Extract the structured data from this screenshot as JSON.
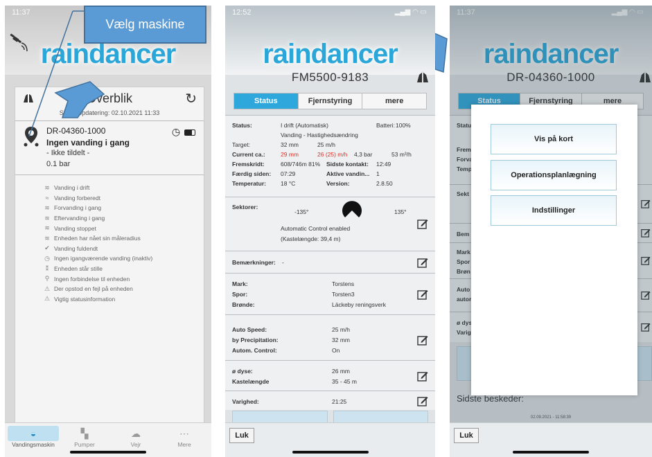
{
  "callout": {
    "label": "Vælg maskine"
  },
  "panel1": {
    "status_time": "11:37",
    "logo": "raindancer",
    "overview": {
      "title": "Overblik",
      "last_update": "Sidste opdatering: 02.10.2021 11:33"
    },
    "machine": {
      "id": "DR-04360-1000",
      "status": "Ingen vanding i gang",
      "assigned": "- Ikke tildelt -",
      "pressure": "0.1 bar"
    },
    "legend": [
      {
        "icon": "sprinkler-icon",
        "glyph": "≋",
        "label": "Vanding i drift"
      },
      {
        "icon": "sprinkler-ready-icon",
        "glyph": "≈",
        "label": "Vanding forberedt"
      },
      {
        "icon": "pre-irrigation-icon",
        "glyph": "≋",
        "label": "Forvanding i gang"
      },
      {
        "icon": "post-irrigation-icon",
        "glyph": "≋",
        "label": "Eftervanding i gang"
      },
      {
        "icon": "irrigation-stopped-icon",
        "glyph": "≋",
        "label": "Vanding stoppet"
      },
      {
        "icon": "radius-reached-icon",
        "glyph": "≋",
        "label": "Enheden har nået sin måleradius"
      },
      {
        "icon": "checkmark-icon",
        "glyph": "✔",
        "label": "Vanding fuldendt"
      },
      {
        "icon": "clock-icon",
        "glyph": "◷",
        "label": "Ingen igangværende vanding (inaktiv)"
      },
      {
        "icon": "standstill-icon",
        "glyph": "⁑",
        "label": "Enheden står stille"
      },
      {
        "icon": "no-connection-icon",
        "glyph": "⚲",
        "label": "Ingen forbindelse til enheden"
      },
      {
        "icon": "warning-icon",
        "glyph": "⚠",
        "label": "Der opstod en fejl på enheden"
      },
      {
        "icon": "info-warning-icon",
        "glyph": "⚠",
        "label": "Vigtig statusinformation"
      }
    ],
    "tabs": [
      {
        "label": "Vandingsmaskin",
        "icon": "hose-reel-icon",
        "glyph": "◒"
      },
      {
        "label": "Pumper",
        "icon": "pump-icon",
        "glyph": "▚"
      },
      {
        "label": "Vejr",
        "icon": "weather-icon",
        "glyph": "☁"
      },
      {
        "label": "Mere",
        "icon": "more-icon",
        "glyph": "⋯"
      }
    ]
  },
  "panel2": {
    "status_time": "12:52",
    "logo": "raindancer",
    "machine_id": "FM5500-9183",
    "tabs": [
      "Status",
      "Fjernstyring",
      "mere"
    ],
    "status": {
      "status_label": "Status:",
      "status_value": "I drift (Automatisk)",
      "mode_value": "Vanding - Hastighedsændring",
      "battery_label": "Batteri:",
      "battery_value": "100%",
      "target_label": "Target:",
      "target_mm": "32 mm",
      "target_speed": "25 m/h",
      "current_label": "Current ca.:",
      "current_mm": "29 mm",
      "current_speed": "26 (25) m/h",
      "current_pressure": "4,3 bar",
      "current_flow": "53 m³/h",
      "progress_label": "Fremskridt:",
      "progress_value": "608/746m 81%",
      "last_contact_label": "Sidste kontakt:",
      "last_contact_value": "12:49",
      "finished_label": "Færdig siden:",
      "finished_value": "07:29",
      "active_label": "Aktive vandin...",
      "active_value": "1",
      "temp_label": "Temperatur:",
      "temp_value": "18 °C",
      "version_label": "Version:",
      "version_value": "2.8.50"
    },
    "sectors": {
      "label": "Sektorer:",
      "left_angle": "-135°",
      "right_angle": "135°",
      "control": "Automatic Control enabled",
      "throw_length": "(Kastelængde: 39,4 m)"
    },
    "remarks": {
      "label": "Bemærkninger:",
      "value": "-"
    },
    "field": {
      "mark_label": "Mark:",
      "mark_value": "Torstens",
      "track_label": "Spor:",
      "track_value": "Torsten3",
      "well_label": "Brønde:",
      "well_value": "Läckeby reningsverk"
    },
    "auto": {
      "speed_label": "Auto Speed:",
      "speed_value": "25 m/h",
      "precip_label": "by Precipitation:",
      "precip_value": "32 mm",
      "control_label": "Autom. Control:",
      "control_value": "On"
    },
    "nozzle": {
      "nozzle_label": "ø dyse:",
      "nozzle_value": "26 mm",
      "throw_label": "Kastelængde",
      "throw_value": "35 - 45 m"
    },
    "duration": {
      "label": "Varighed:",
      "value": "21:25"
    },
    "close_label": "Luk"
  },
  "panel3": {
    "status_time": "11:37",
    "logo": "raindancer",
    "machine_id": "DR-04360-1000",
    "tabs": [
      "Status",
      "Fjernstyring",
      "mere"
    ],
    "bg_labels": [
      "Statu",
      "Frem",
      "Forva",
      "Temp",
      "Sekt",
      "Bem",
      "Mark",
      "Spor",
      "Brøn",
      "Auto",
      "autor",
      "ø dys",
      "Varig"
    ],
    "menu": [
      "Vis på kort",
      "Operationsplanlægning",
      "Indstillinger"
    ],
    "last_messages": "Sidste beskeder:",
    "last_messages_date": "02.09.2021 - 11:58:39",
    "close_label": "Luk"
  },
  "colors": {
    "brand_blue": "#2aa7d8",
    "callout_blue": "#5b9bd5",
    "warning_red": "#d8322b"
  }
}
